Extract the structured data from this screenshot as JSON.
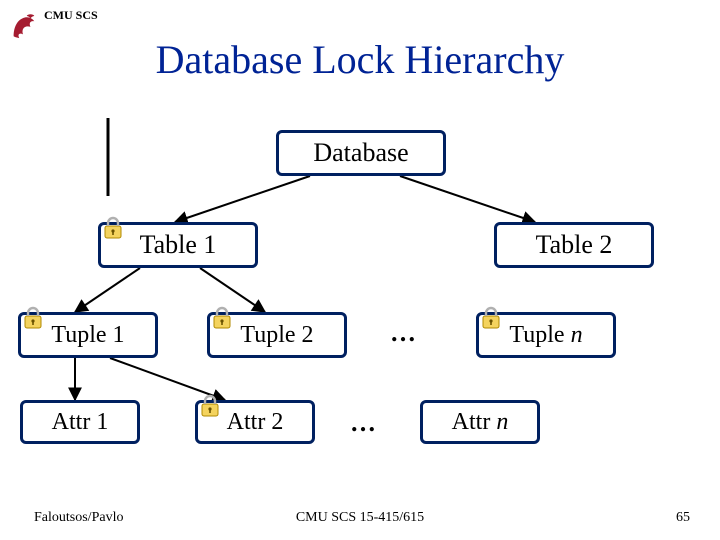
{
  "header": {
    "org": "CMU SCS"
  },
  "title": "Database Lock Hierarchy",
  "nodes": {
    "database": "Database",
    "table1": "Table 1",
    "table2": "Table 2",
    "tuple1": "Tuple 1",
    "tuple2": "Tuple 2",
    "tuplen_pre": "Tuple ",
    "tuplen_suf": "n",
    "attr1": "Attr 1",
    "attr2": "Attr 2",
    "attrn_pre": "Attr ",
    "attrn_suf": "n"
  },
  "ellipsis": "…",
  "footer": {
    "left": "Faloutsos/Pavlo",
    "center": "CMU SCS 15-415/615",
    "right": "65"
  },
  "colors": {
    "title": "#002395",
    "border": "#002060",
    "logo": "#a51c30"
  }
}
